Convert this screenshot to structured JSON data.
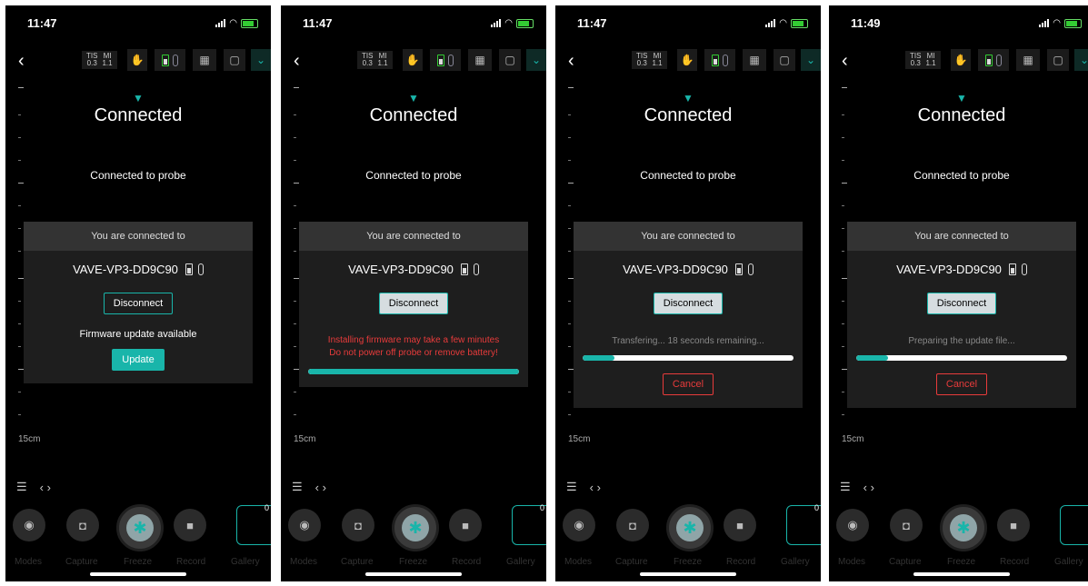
{
  "common": {
    "connected_title": "Connected",
    "connected_sub": "Connected to probe",
    "connected_to": "You are connected to",
    "probe_name": "VAVE-VP3-DD9C90",
    "disconnect": "Disconnect",
    "cancel": "Cancel",
    "tis_label": "TIS",
    "tis_value": "0.3",
    "mi_label": "MI",
    "mi_value": "1.1",
    "depth": "15cm",
    "gallery_count": "0",
    "bottom": {
      "modes": "Modes",
      "capture": "Capture",
      "freeze": "Freeze",
      "record": "Record",
      "gallery": "Gallery"
    },
    "accent_color": "#19b5aa",
    "warn_color": "#e83b3b"
  },
  "screens": [
    {
      "time": "11:47",
      "firmware": "Firmware update available",
      "update": "Update"
    },
    {
      "time": "11:47",
      "warning_1": "Installing firmware may take a few minutes",
      "warning_2": "Do not power off probe or remove battery!",
      "progress": 1.0
    },
    {
      "time": "11:47",
      "status": "Transfering... 18 seconds remaining...",
      "progress": 0.15
    },
    {
      "time": "11:49",
      "status": "Preparing the update file...",
      "progress": 0.15
    }
  ]
}
